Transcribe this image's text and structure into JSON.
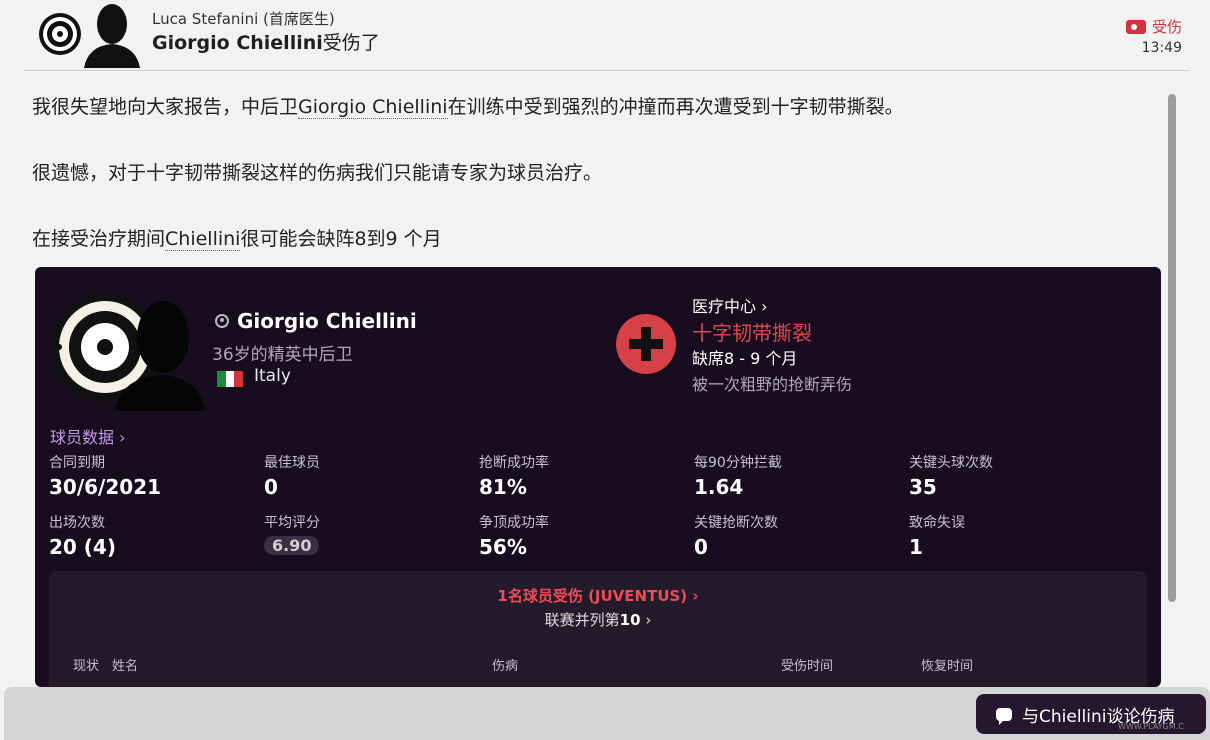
{
  "header": {
    "sender": "Luca Stefanini (首席医生)",
    "subject_name": "Giorgio Chiellini",
    "subject_rest": "受伤了",
    "tag": "受伤",
    "time": "13:49"
  },
  "body": {
    "p1_a": "我很失望地向大家报告，中后卫",
    "p1_name": "Giorgio Chiellini",
    "p1_b": "在训练中受到强烈的冲撞而再次遭受到十字韧带撕裂。",
    "p2": "很遗憾，对于十字韧带撕裂这样的伤病我们只能请专家为球员治疗。",
    "p3_a": "在接受治疗期间",
    "p3_name": "Chiellini",
    "p3_b": "很可能会缺阵8到9 个月"
  },
  "player": {
    "name": "Giorgio Chiellini",
    "desc": "36岁的精英中后卫",
    "nation": "Italy"
  },
  "injury": {
    "link": "医疗中心 ›",
    "name": "十字韧带撕裂",
    "out": "缺席8 - 9 个月",
    "cause": "被一次粗野的抢断弄伤"
  },
  "stats_link": "球员数据 ›",
  "stats": [
    {
      "label": "合同到期",
      "value": "30/6/2021"
    },
    {
      "label": "最佳球员",
      "value": "0"
    },
    {
      "label": "抢断成功率",
      "value": "81%"
    },
    {
      "label": "每90分钟拦截",
      "value": "1.64"
    },
    {
      "label": "关键头球次数",
      "value": "35"
    },
    {
      "label": "出场次数",
      "value": "20 (4)"
    },
    {
      "label": "平均评分",
      "value": "6.90"
    },
    {
      "label": "争顶成功率",
      "value": "56%"
    },
    {
      "label": "关键抢断次数",
      "value": "0"
    },
    {
      "label": "致命失误",
      "value": "1"
    }
  ],
  "club_injuries": {
    "title": "1名球员受伤 (JUVENTUS) ›",
    "league_a": "联赛并列第",
    "league_num": "10",
    "league_b": " ›",
    "columns": [
      "现状",
      "姓名",
      "伤病",
      "受伤时间",
      "恢复时间"
    ]
  },
  "talk_button": "与Chiellini谈论伤病",
  "watermark": "WWW.PLAYGM.C",
  "colors": {
    "accent_red": "#e0484f",
    "panel_bg": "#170d1f",
    "link_purple": "#c59ae8"
  },
  "icons": [
    "club-badge-icon",
    "player-silhouette-icon",
    "medical-cross-icon",
    "injury-tag-icon",
    "chat-icon",
    "italy-flag-icon"
  ]
}
